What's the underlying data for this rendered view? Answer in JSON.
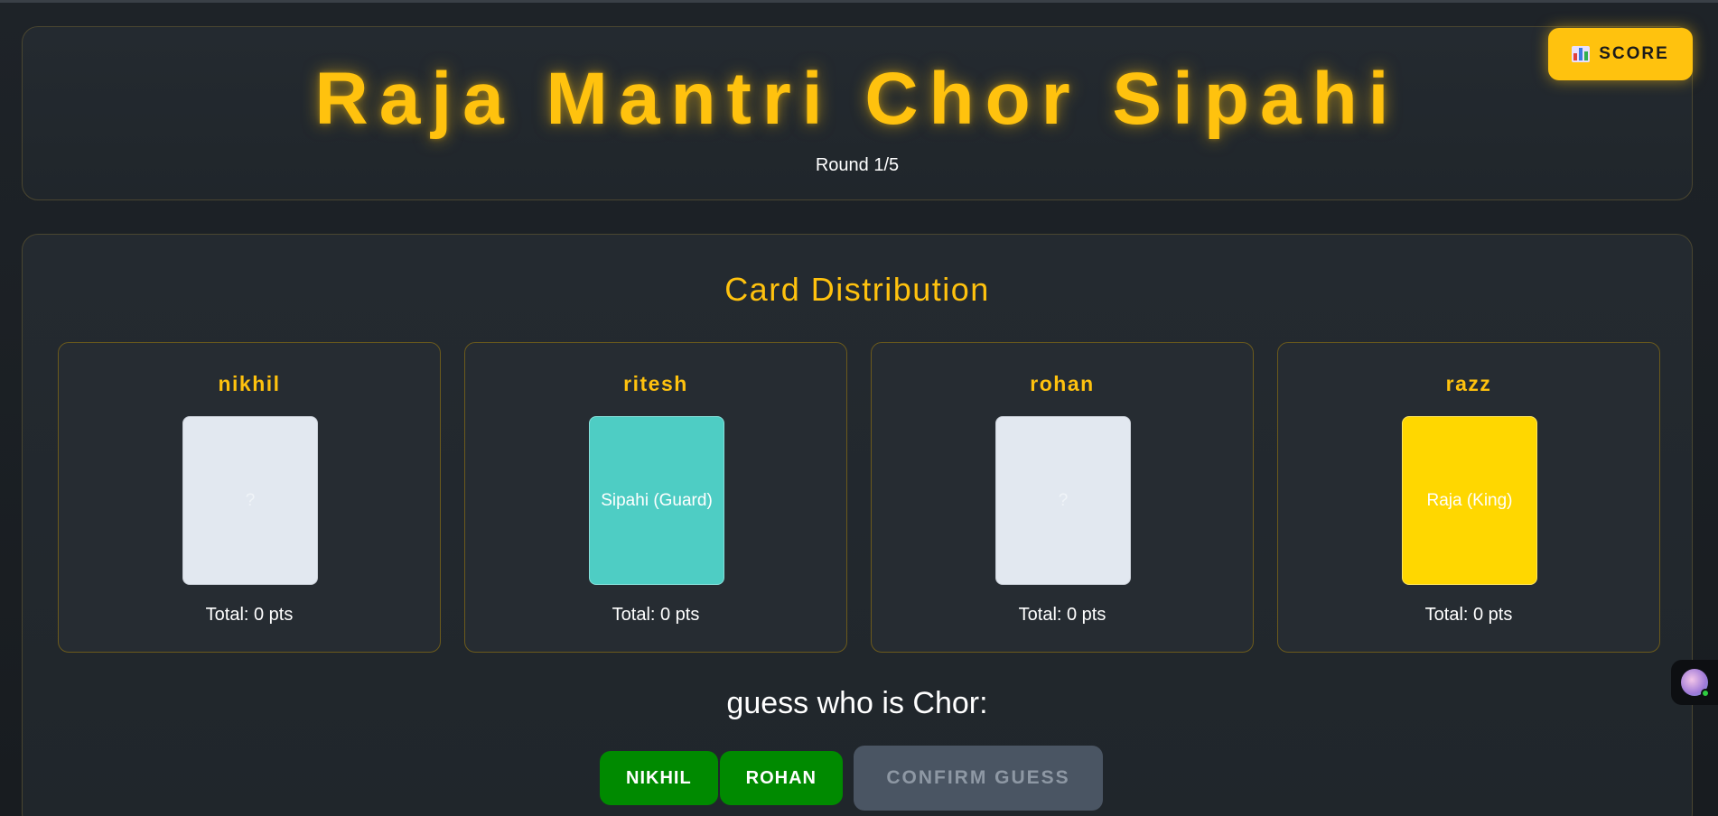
{
  "header": {
    "title": "Raja Mantri Chor Sipahi",
    "round": "Round 1/5",
    "score_button": {
      "icon": "bar-chart-icon",
      "label": "SCORE"
    }
  },
  "distribution": {
    "title": "Card Distribution",
    "players": [
      {
        "name": "nikhil",
        "card": "?",
        "card_state": "hidden",
        "total": "Total: 0 pts"
      },
      {
        "name": "ritesh",
        "card": "Sipahi (Guard)",
        "card_state": "revealed",
        "card_color": "#4ecdc4",
        "total": "Total: 0 pts"
      },
      {
        "name": "rohan",
        "card": "?",
        "card_state": "hidden",
        "total": "Total: 0 pts"
      },
      {
        "name": "razz",
        "card": "Raja (King)",
        "card_state": "revealed",
        "card_color": "#ffd700",
        "total": "Total: 0 pts"
      }
    ]
  },
  "guess": {
    "prompt": "guess who is Chor:",
    "options": [
      "NIKHIL",
      "ROHAN"
    ],
    "confirm_label": "CONFIRM GUESS"
  },
  "colors": {
    "accent": "#ffc20e",
    "guess_button": "#008a00",
    "confirm_disabled": "#4a5563"
  }
}
